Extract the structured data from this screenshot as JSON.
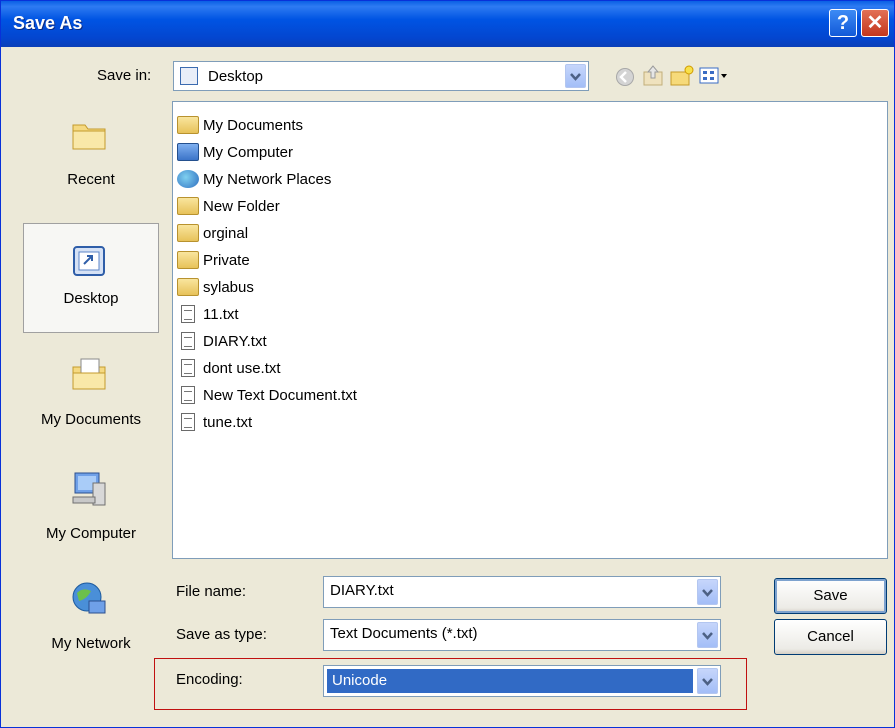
{
  "window": {
    "title": "Save As",
    "help_glyph": "?",
    "close_glyph": "✕"
  },
  "toolbar": {
    "save_in_label": "Save in:",
    "save_in_value": "Desktop",
    "dropdown_glyph": "▼"
  },
  "places": [
    {
      "label": "Recent",
      "icon": "recent-folder-icon"
    },
    {
      "label": "Desktop",
      "icon": "desktop-icon",
      "selected": true
    },
    {
      "label": "My Documents",
      "icon": "my-documents-icon"
    },
    {
      "label": "My Computer",
      "icon": "my-computer-icon"
    },
    {
      "label": "My Network",
      "icon": "my-network-icon"
    }
  ],
  "files": [
    {
      "name": "My Documents",
      "icon": "my-documents-icon"
    },
    {
      "name": "My Computer",
      "icon": "my-computer-icon"
    },
    {
      "name": "My Network Places",
      "icon": "network-places-icon"
    },
    {
      "name": "New Folder",
      "icon": "folder-icon"
    },
    {
      "name": "orginal",
      "icon": "folder-icon"
    },
    {
      "name": "Private",
      "icon": "folder-icon"
    },
    {
      "name": "sylabus",
      "icon": "folder-icon"
    },
    {
      "name": "11.txt",
      "icon": "text-file-icon"
    },
    {
      "name": "DIARY.txt",
      "icon": "text-file-icon"
    },
    {
      "name": "dont use.txt",
      "icon": "text-file-icon"
    },
    {
      "name": "New Text Document.txt",
      "icon": "text-file-icon"
    },
    {
      "name": "tune.txt",
      "icon": "text-file-icon"
    }
  ],
  "form": {
    "file_name_label": "File name:",
    "file_name_value": "DIARY.txt",
    "save_type_label": "Save as type:",
    "save_type_value": "Text Documents (*.txt)",
    "encoding_label": "Encoding:",
    "encoding_value": "Unicode"
  },
  "buttons": {
    "save": "Save",
    "cancel": "Cancel"
  },
  "colors": {
    "title_bar": "#0054E3",
    "selection": "#316AC5",
    "highlight_box": "#C01010"
  }
}
